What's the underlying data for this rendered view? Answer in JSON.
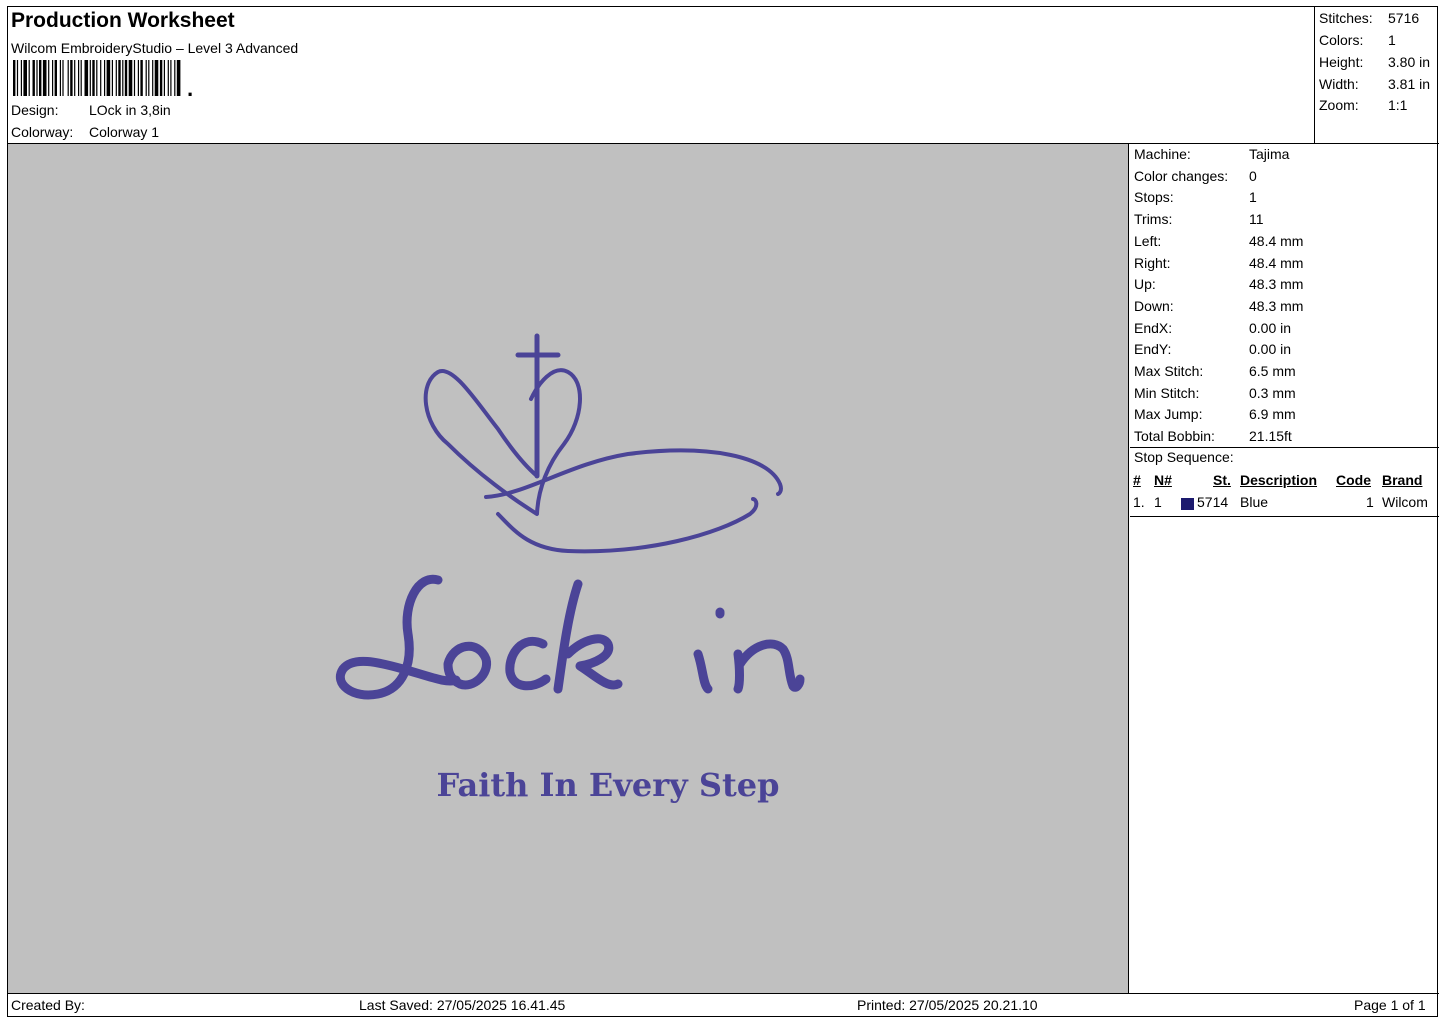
{
  "header": {
    "title": "Production Worksheet",
    "software": "Wilcom EmbroideryStudio – Level 3 Advanced",
    "design_label": "Design:",
    "design_value": "LOck in 3,8in",
    "colorway_label": "Colorway:",
    "colorway_value": "Colorway 1"
  },
  "stats": [
    {
      "label": "Stitches:",
      "value": "5716"
    },
    {
      "label": "Colors:",
      "value": "1"
    },
    {
      "label": "Height:",
      "value": "3.80 in"
    },
    {
      "label": "Width:",
      "value": "3.81 in"
    },
    {
      "label": "Zoom:",
      "value": "1:1"
    }
  ],
  "machine_info": [
    {
      "label": "Machine:",
      "value": "Tajima"
    },
    {
      "label": "Color changes:",
      "value": "0"
    },
    {
      "label": "Stops:",
      "value": "1"
    },
    {
      "label": "Trims:",
      "value": "11"
    },
    {
      "label": "Left:",
      "value": "48.4 mm"
    },
    {
      "label": "Right:",
      "value": "48.4 mm"
    },
    {
      "label": "Up:",
      "value": "48.3 mm"
    },
    {
      "label": "Down:",
      "value": "48.3 mm"
    },
    {
      "label": "EndX:",
      "value": "0.00 in"
    },
    {
      "label": "EndY:",
      "value": "0.00 in"
    },
    {
      "label": "Max Stitch:",
      "value": "6.5 mm"
    },
    {
      "label": "Min Stitch:",
      "value": "0.3 mm"
    },
    {
      "label": "Max Jump:",
      "value": "6.9 mm"
    },
    {
      "label": "Total Bobbin:",
      "value": "21.15ft"
    }
  ],
  "stop_sequence": {
    "title": "Stop Sequence:",
    "headers": {
      "num": "#",
      "needle": "N#",
      "stitches": "St.",
      "description": "Description",
      "code": "Code",
      "brand": "Brand"
    },
    "rows": [
      {
        "num": "1.",
        "needle": "1",
        "stitches": "5714",
        "description": "Blue",
        "code": "1",
        "brand": "Wilcom",
        "color": "#1c1a6e"
      }
    ]
  },
  "design": {
    "main_text": "Lock in",
    "tagline": "Faith In Every Step",
    "thread_color": "#4b4497",
    "background_color": "#c0c0c0"
  },
  "footer": {
    "created_by": "Created By:",
    "last_saved": "Last Saved: 27/05/2025 16.41.45",
    "printed": "Printed: 27/05/2025 20.21.10",
    "page": "Page 1 of 1"
  }
}
